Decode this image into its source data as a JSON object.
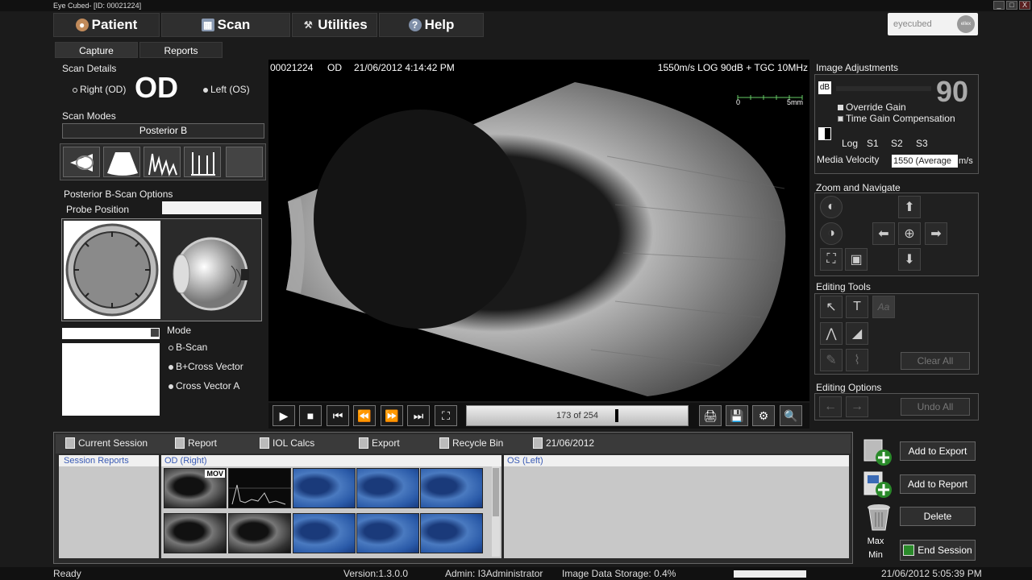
{
  "window": {
    "title": "Eye Cubed- [ID: 00021224]",
    "controls": [
      "_",
      "□",
      "X"
    ]
  },
  "menu": {
    "patient": "Patient",
    "scan": "Scan",
    "utilities": "Utilities",
    "help": "Help"
  },
  "logo": {
    "text": "eyecubed",
    "badge": "ellex"
  },
  "subtabs": {
    "capture": "Capture",
    "reports": "Reports"
  },
  "scan_details": {
    "title": "Scan Details",
    "eye": "OD",
    "right_label": "Right (OD)",
    "left_label": "Left (OS)"
  },
  "scan_modes": {
    "title": "Scan Modes",
    "selected": "Posterior B"
  },
  "bscan_options": {
    "title": "Posterior B-Scan Options",
    "probe_position": "Probe Position"
  },
  "mode": {
    "title": "Mode",
    "options": [
      "B-Scan",
      "B+Cross Vector",
      "Cross Vector A"
    ]
  },
  "image_header": {
    "id": "00021224",
    "eye": "OD",
    "datetime": "21/06/2012 4:14:42 PM",
    "settings": "1550m/s LOG 90dB + TGC 10MHz",
    "scale_start": "0",
    "scale_end": "5mm"
  },
  "playback": {
    "frame_text": "173 of 254",
    "progress": 0.68
  },
  "image_adjustments": {
    "title": "Image Adjustments",
    "db_label": "dB",
    "gain_value": "90",
    "override_gain": "Override Gain",
    "tgc": "Time Gain Compensation",
    "log": "Log",
    "s1": "S1",
    "s2": "S2",
    "s3": "S3",
    "media_velocity_label": "Media Velocity",
    "media_velocity_value": "1550 (Average",
    "media_velocity_unit": "m/s"
  },
  "zoom": {
    "title": "Zoom and Navigate"
  },
  "editing_tools": {
    "title": "Editing Tools",
    "text_tool": "T",
    "font_tool": "Aa",
    "clear_all": "Clear All"
  },
  "editing_options": {
    "title": "Editing Options",
    "undo_all": "Undo All"
  },
  "session_tabs": [
    "Current Session",
    "Report",
    "IOL Calcs",
    "Export",
    "Recycle Bin",
    "21/06/2012"
  ],
  "session": {
    "reports_label": "Session Reports",
    "od_label": "OD (Right)",
    "os_label": "OS (Left)",
    "mov_badge": "MOV"
  },
  "actions": {
    "add_export": "Add to Export",
    "add_report": "Add to Report",
    "delete": "Delete",
    "max": "Max",
    "min": "Min",
    "end_session": "End Session"
  },
  "status": {
    "ready": "Ready",
    "version": "Version:1.3.0.0",
    "admin": "Admin: I3Administrator",
    "storage": "Image Data Storage: 0.4%",
    "datetime": "21/06/2012 5:05:39 PM"
  }
}
